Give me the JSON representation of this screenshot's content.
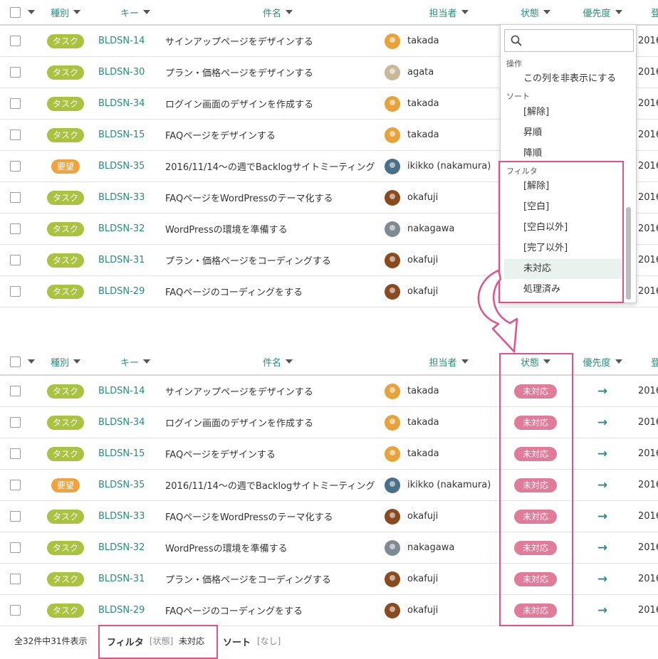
{
  "columns": {
    "type": "種別",
    "key": "キー",
    "subject": "件名",
    "assignee": "担当者",
    "status": "状態",
    "priority": "優先度",
    "date": "登"
  },
  "date_prefix": "2016",
  "top_rows": [
    {
      "type": "タスク",
      "key": "BLDSN-14",
      "subject": "サインアップページをデザインする",
      "assignee": "takada",
      "avatar_color": "#e8a23b"
    },
    {
      "type": "タスク",
      "key": "BLDSN-30",
      "subject": "プラン・価格ページをデザインする",
      "assignee": "agata",
      "avatar_color": "#c9b79a"
    },
    {
      "type": "タスク",
      "key": "BLDSN-34",
      "subject": "ログイン画面のデザインを作成する",
      "assignee": "takada",
      "avatar_color": "#e8a23b"
    },
    {
      "type": "タスク",
      "key": "BLDSN-15",
      "subject": "FAQページをデザインする",
      "assignee": "takada",
      "avatar_color": "#e8a23b"
    },
    {
      "type": "要望",
      "key": "BLDSN-35",
      "subject": "2016/11/14〜の週でBacklogサイトミーティング",
      "assignee": "ikikko (nakamura)",
      "avatar_color": "#4a6f8a"
    },
    {
      "type": "タスク",
      "key": "BLDSN-33",
      "subject": "FAQページをWordPressのテーマ化する",
      "assignee": "okafuji",
      "avatar_color": "#8a4a1f"
    },
    {
      "type": "タスク",
      "key": "BLDSN-32",
      "subject": "WordPressの環境を準備する",
      "assignee": "nakagawa",
      "avatar_color": "#7f8a93"
    },
    {
      "type": "タスク",
      "key": "BLDSN-31",
      "subject": "プラン・価格ページをコーディングする",
      "assignee": "okafuji",
      "avatar_color": "#8a4a1f"
    },
    {
      "type": "タスク",
      "key": "BLDSN-29",
      "subject": "FAQページのコーディングをする",
      "assignee": "okafuji",
      "avatar_color": "#8a4a1f"
    }
  ],
  "bottom_rows": [
    {
      "type": "タスク",
      "key": "BLDSN-14",
      "subject": "サインアップページをデザインする",
      "assignee": "takada",
      "avatar_color": "#e8a23b",
      "status": "未対応"
    },
    {
      "type": "タスク",
      "key": "BLDSN-34",
      "subject": "ログイン画面のデザインを作成する",
      "assignee": "takada",
      "avatar_color": "#e8a23b",
      "status": "未対応"
    },
    {
      "type": "タスク",
      "key": "BLDSN-15",
      "subject": "FAQページをデザインする",
      "assignee": "takada",
      "avatar_color": "#e8a23b",
      "status": "未対応"
    },
    {
      "type": "要望",
      "key": "BLDSN-35",
      "subject": "2016/11/14〜の週でBacklogサイトミーティング",
      "assignee": "ikikko (nakamura)",
      "avatar_color": "#4a6f8a",
      "status": "未対応"
    },
    {
      "type": "タスク",
      "key": "BLDSN-33",
      "subject": "FAQページをWordPressのテーマ化する",
      "assignee": "okafuji",
      "avatar_color": "#8a4a1f",
      "status": "未対応"
    },
    {
      "type": "タスク",
      "key": "BLDSN-32",
      "subject": "WordPressの環境を準備する",
      "assignee": "nakagawa",
      "avatar_color": "#7f8a93",
      "status": "未対応"
    },
    {
      "type": "タスク",
      "key": "BLDSN-31",
      "subject": "プラン・価格ページをコーディングする",
      "assignee": "okafuji",
      "avatar_color": "#8a4a1f",
      "status": "未対応"
    },
    {
      "type": "タスク",
      "key": "BLDSN-29",
      "subject": "FAQページのコーディングをする",
      "assignee": "okafuji",
      "avatar_color": "#8a4a1f",
      "status": "未対応"
    }
  ],
  "type_colors": {
    "タスク": "#a9c23f",
    "要望": "#f0a33a"
  },
  "dropdown": {
    "search_placeholder": "",
    "section_ops": "操作",
    "hide_column": "この列を非表示にする",
    "section_sort": "ソート",
    "sort_items": [
      "[解除]",
      "昇順",
      "降順"
    ],
    "section_filter": "フィルタ",
    "filter_items": [
      "[解除]",
      "[空白]",
      "[空白以外]",
      "[完了以外]",
      "未対応",
      "処理済み"
    ],
    "selected_filter": "未対応"
  },
  "footer": {
    "count": "全32件中31件表示",
    "filter_label": "フィルタ",
    "filter_field": "[状態]",
    "filter_value": "未対応",
    "sort_label": "ソート",
    "sort_value": "[なし]"
  },
  "colors": {
    "accent": "#2a8b7b",
    "status_pink": "#e07b9a",
    "highlight": "#e0538a"
  }
}
